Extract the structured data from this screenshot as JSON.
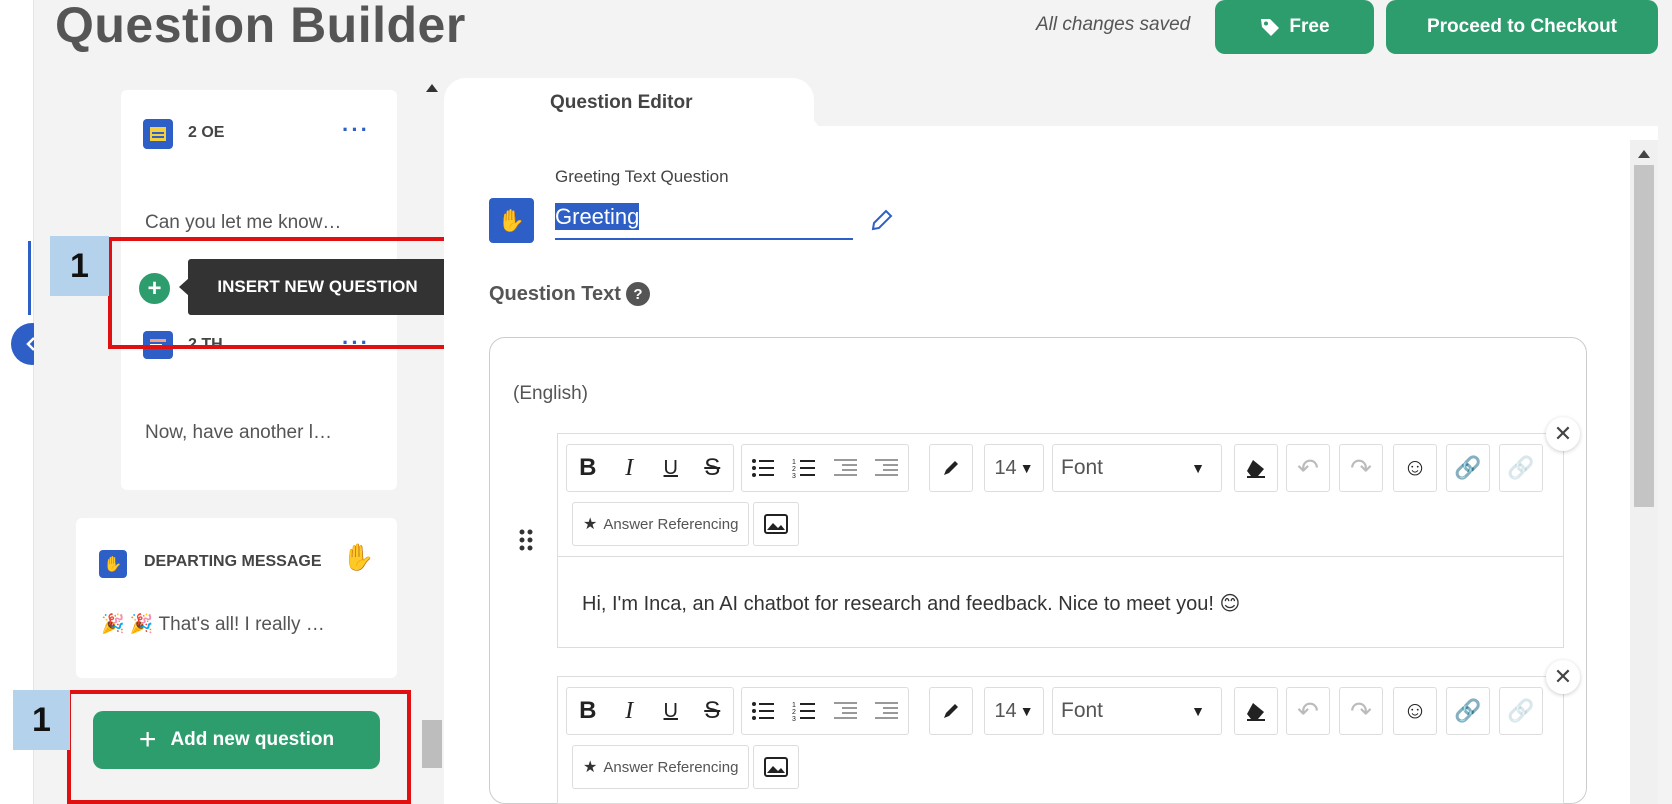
{
  "header": {
    "title": "Question Builder",
    "save_status": "All changes saved",
    "free_label": "Free",
    "checkout_label": "Proceed to Checkout"
  },
  "questions": [
    {
      "code": "2 OE",
      "preview": "Can you let me know…",
      "icon": "open-ended-icon"
    },
    {
      "code": "2 TH",
      "preview": "Now, have another l…",
      "icon": "thematic-icon"
    }
  ],
  "insert_tooltip": "INSERT NEW QUESTION",
  "departing": {
    "label": "DEPARTING MESSAGE",
    "preview": "🎉 🎉 That's all! I really …"
  },
  "add_question_label": "Add new question",
  "annotations": {
    "step1": "1",
    "step2": "1"
  },
  "editor": {
    "tab_label": "Question Editor",
    "question_type": "Greeting Text Question",
    "question_name": "Greeting",
    "question_text_label": "Question Text",
    "help": "?",
    "language": "(English)",
    "toolbar": {
      "font_size": "14",
      "font": "Font",
      "answer_referencing": "Answer Referencing"
    },
    "message_1": "Hi, I'm Inca, an AI chatbot for research and feedback. Nice to meet you! 😊"
  },
  "colors": {
    "brand_green": "#2e9d6e",
    "brand_blue": "#2d5fc7",
    "annotation_red": "#e01010",
    "annotation_blue": "#b5d2ec"
  }
}
